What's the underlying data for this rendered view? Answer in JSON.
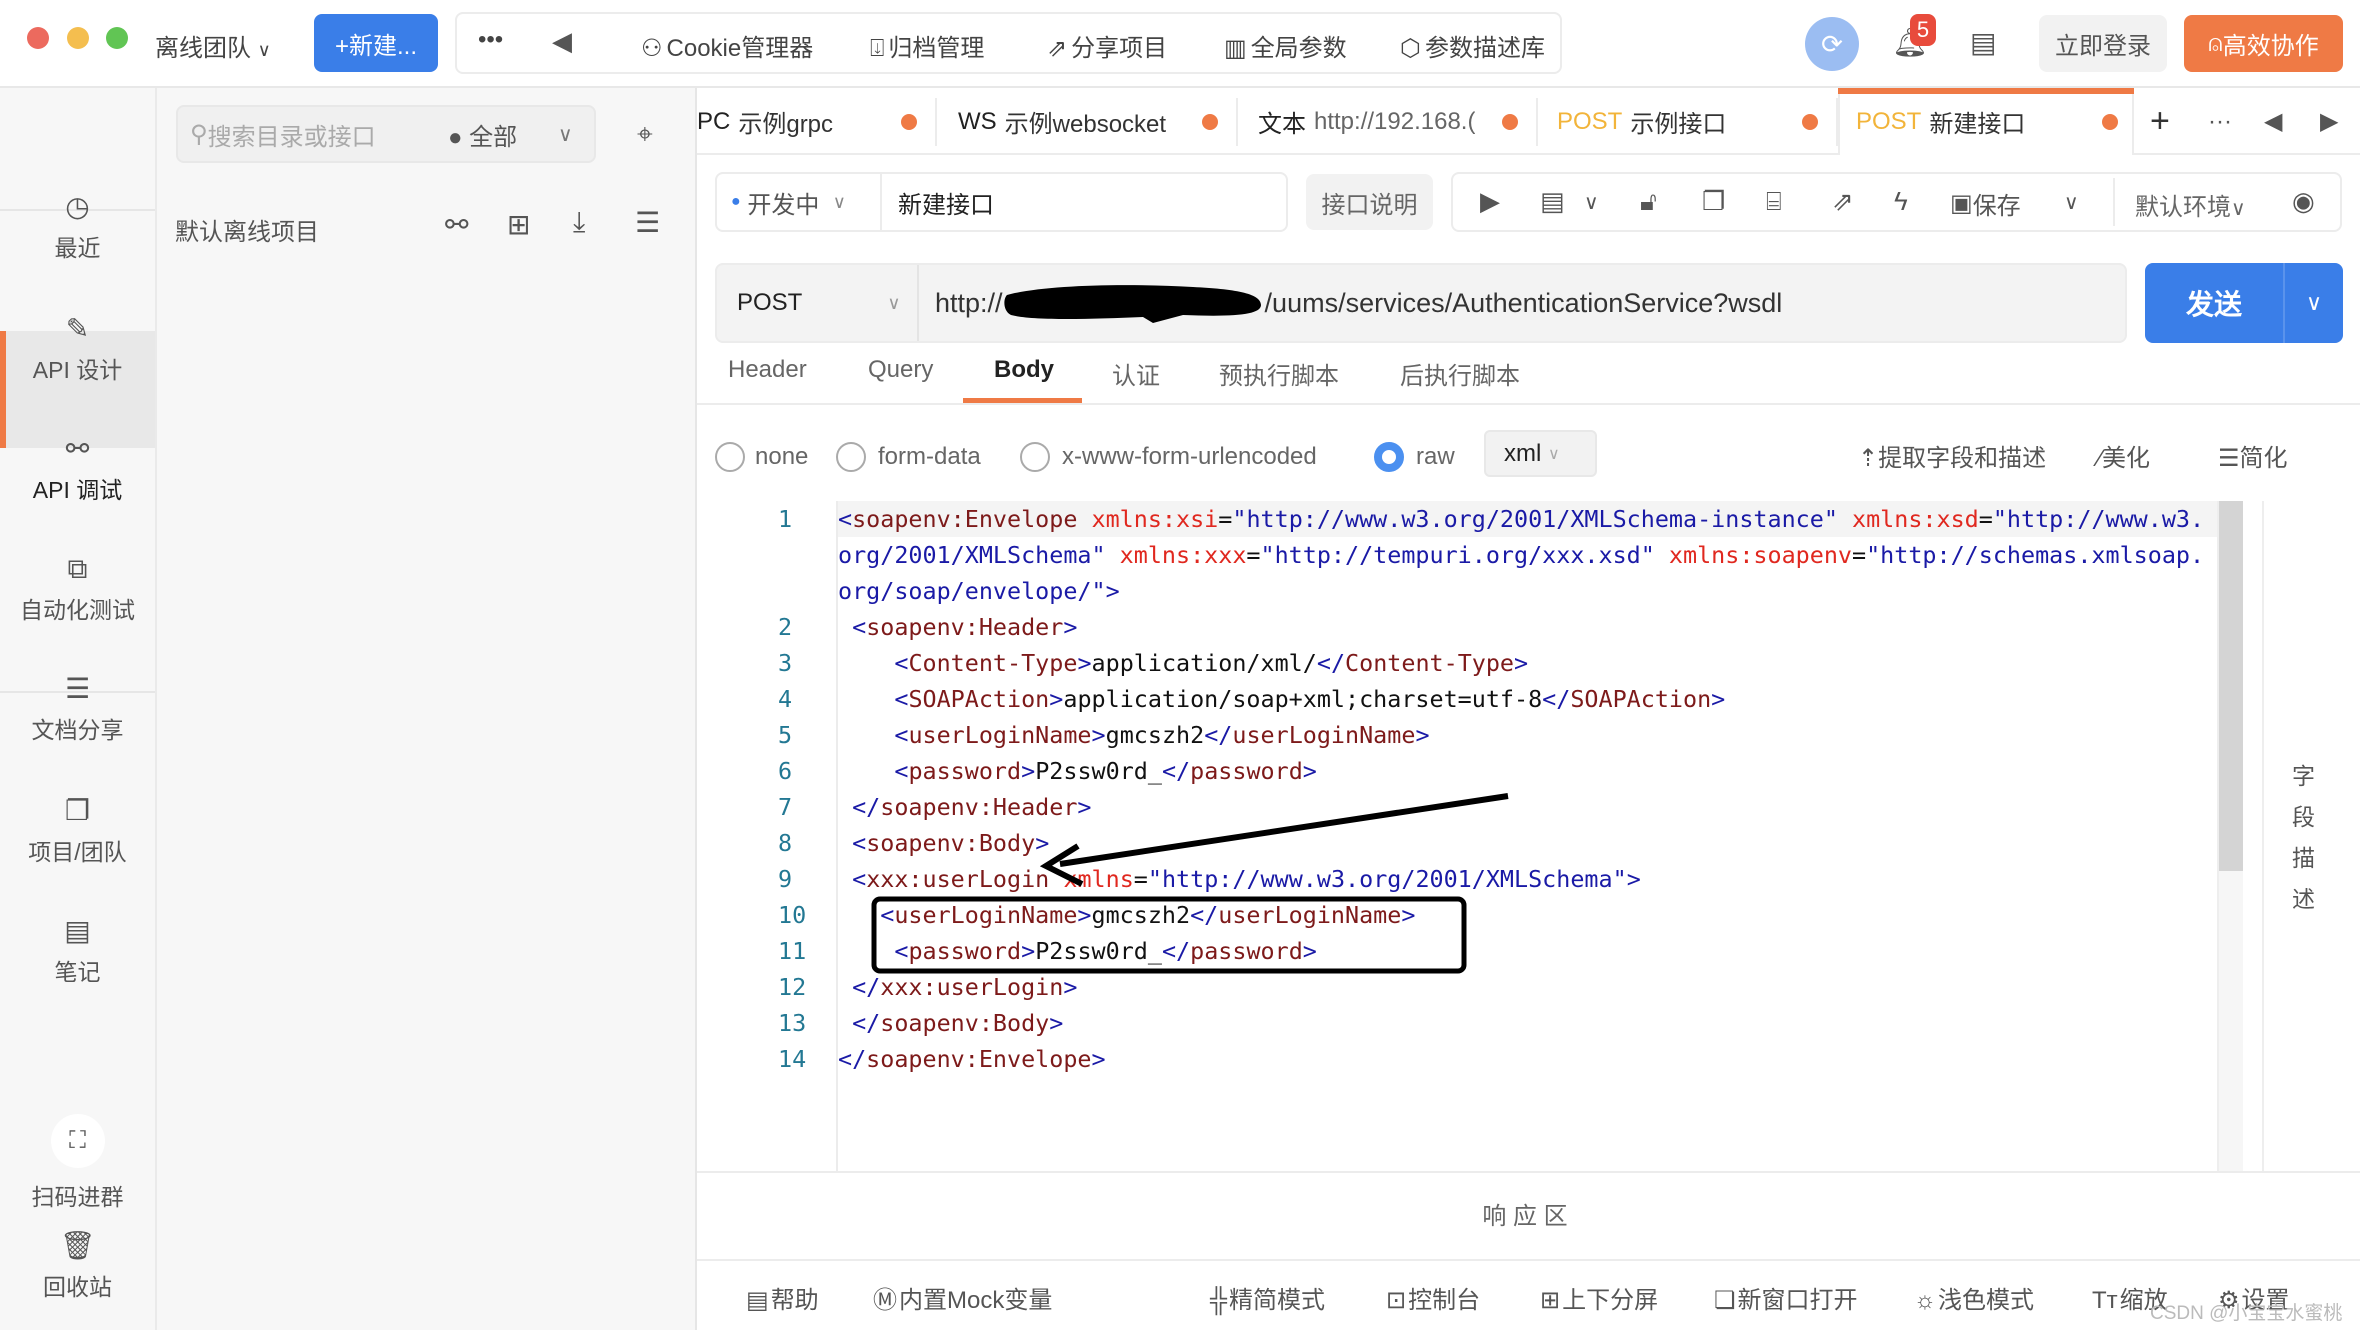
{
  "topbar": {
    "team": "离线团队",
    "new_button": "+新建...",
    "more": "•••",
    "tools": [
      {
        "icon": "cookie-icon",
        "glyph": "⚇",
        "label": "Cookie管理器"
      },
      {
        "icon": "archive-icon",
        "glyph": "⍗",
        "label": "归档管理"
      },
      {
        "icon": "share-icon",
        "glyph": "⇗",
        "label": "分享项目"
      },
      {
        "icon": "sliders-icon",
        "glyph": "▥",
        "label": "全局参数"
      },
      {
        "icon": "cube-icon",
        "glyph": "⬡",
        "label": "参数描述库"
      }
    ],
    "notification_count": "5",
    "login": "立即登录",
    "collab": "高效协作",
    "accent": "#ef7a45",
    "primary": "#3a7ee8"
  },
  "sidebar": {
    "items": [
      {
        "label": "最近",
        "icon": "clock-icon",
        "glyph": "◷"
      },
      {
        "label": "API 设计",
        "icon": "edit-icon",
        "glyph": "✎"
      },
      {
        "label": "API 调试",
        "icon": "plug-icon",
        "glyph": "⚯",
        "active": true
      },
      {
        "label": "自动化测试",
        "icon": "flow-icon",
        "glyph": "⧉"
      },
      {
        "label": "文档分享",
        "icon": "doc-share-icon",
        "glyph": "☰"
      },
      {
        "label": "项目/团队",
        "icon": "folder-icon",
        "glyph": "❐"
      },
      {
        "label": "笔记",
        "icon": "note-icon",
        "glyph": "▤"
      },
      {
        "label": "扫码进群",
        "icon": "scan-icon",
        "glyph": "⛶"
      },
      {
        "label": "回收站",
        "icon": "trash-icon",
        "glyph": "🗑"
      }
    ]
  },
  "panel": {
    "search_placeholder": "搜索目录或接口",
    "filter": "全部",
    "project": "默认离线项目"
  },
  "tabs": [
    {
      "method": "PC",
      "name": "示例grpc"
    },
    {
      "method": "WS",
      "name": "示例websocket"
    },
    {
      "method": "文本",
      "name": "http://192.168.("
    },
    {
      "method": "POST",
      "name": "示例接口"
    },
    {
      "method": "POST",
      "name": "新建接口",
      "active": true
    }
  ],
  "request": {
    "status": "开发中",
    "name": "新建接口",
    "doc_button": "接口说明",
    "save": "保存",
    "env": "默认环境",
    "method": "POST",
    "url_prefix": "http://",
    "url_suffix": "/uums/services/AuthenticationService?wsdl",
    "send": "发送"
  },
  "subtabs": [
    "Header",
    "Query",
    "Body",
    "认证",
    "预执行脚本",
    "后执行脚本"
  ],
  "body": {
    "types": [
      "none",
      "form-data",
      "x-www-form-urlencoded",
      "raw"
    ],
    "selected": "raw",
    "format": "xml",
    "extract": "提取字段和描述",
    "beautify": "美化",
    "simplify": "简化",
    "field_desc": "字段描述"
  },
  "code": [
    [
      [
        "b",
        "<"
      ],
      [
        "t",
        "soapenv:Envelope"
      ],
      [
        "x",
        " "
      ],
      [
        "a",
        "xmlns:xsi"
      ],
      [
        "e",
        "="
      ],
      [
        "v",
        "\"http://www.w3.org/2001/XMLSchema-instance\""
      ],
      [
        "x",
        " "
      ],
      [
        "a",
        "xmlns:xsd"
      ],
      [
        "e",
        "="
      ],
      [
        "v",
        "\"http://www.w3.org/2001/XMLSchema\""
      ],
      [
        "x",
        " "
      ],
      [
        "a",
        "xmlns:xxx"
      ],
      [
        "e",
        "="
      ],
      [
        "v",
        "\"http://tempuri.org/xxx.xsd\""
      ],
      [
        "x",
        " "
      ],
      [
        "a",
        "xmlns:soapenv"
      ],
      [
        "e",
        "="
      ],
      [
        "v",
        "\"http://schemas.xmlsoap.org/soap/envelope/\""
      ],
      [
        "b",
        ">"
      ]
    ],
    [
      [
        "x",
        " "
      ],
      [
        "b",
        "<"
      ],
      [
        "t",
        "soapenv:Header"
      ],
      [
        "b",
        ">"
      ]
    ],
    [
      [
        "x",
        "    "
      ],
      [
        "b",
        "<"
      ],
      [
        "t",
        "Content-Type"
      ],
      [
        "b",
        ">"
      ],
      [
        "x",
        "application/xml/"
      ],
      [
        "b",
        "</"
      ],
      [
        "t",
        "Content-Type"
      ],
      [
        "b",
        ">"
      ]
    ],
    [
      [
        "x",
        "    "
      ],
      [
        "b",
        "<"
      ],
      [
        "t",
        "SOAPAction"
      ],
      [
        "b",
        ">"
      ],
      [
        "x",
        "application/soap+xml;charset=utf-8"
      ],
      [
        "b",
        "</"
      ],
      [
        "t",
        "SOAPAction"
      ],
      [
        "b",
        ">"
      ]
    ],
    [
      [
        "x",
        "    "
      ],
      [
        "b",
        "<"
      ],
      [
        "t",
        "userLoginName"
      ],
      [
        "b",
        ">"
      ],
      [
        "x",
        "gmcszh2"
      ],
      [
        "b",
        "</"
      ],
      [
        "t",
        "userLoginName"
      ],
      [
        "b",
        ">"
      ]
    ],
    [
      [
        "x",
        "    "
      ],
      [
        "b",
        "<"
      ],
      [
        "t",
        "password"
      ],
      [
        "b",
        ">"
      ],
      [
        "x",
        "P2ssw0rd_"
      ],
      [
        "b",
        "</"
      ],
      [
        "t",
        "password"
      ],
      [
        "b",
        ">"
      ]
    ],
    [
      [
        "x",
        " "
      ],
      [
        "b",
        "</"
      ],
      [
        "t",
        "soapenv:Header"
      ],
      [
        "b",
        ">"
      ]
    ],
    [
      [
        "x",
        " "
      ],
      [
        "b",
        "<"
      ],
      [
        "t",
        "soapenv:Body"
      ],
      [
        "b",
        ">"
      ]
    ],
    [
      [
        "x",
        " "
      ],
      [
        "b",
        "<"
      ],
      [
        "t",
        "xxx:userLogin"
      ],
      [
        "x",
        " "
      ],
      [
        "a",
        "xmlns"
      ],
      [
        "e",
        "="
      ],
      [
        "v",
        "\"http://www.w3.org/2001/XMLSchema\""
      ],
      [
        "b",
        ">"
      ]
    ],
    [
      [
        "x",
        "   "
      ],
      [
        "b",
        "<"
      ],
      [
        "t",
        "userLoginName"
      ],
      [
        "b",
        ">"
      ],
      [
        "x",
        "gmcszh2"
      ],
      [
        "b",
        "</"
      ],
      [
        "t",
        "userLoginName"
      ],
      [
        "b",
        ">"
      ]
    ],
    [
      [
        "x",
        "    "
      ],
      [
        "b",
        "<"
      ],
      [
        "t",
        "password"
      ],
      [
        "b",
        ">"
      ],
      [
        "x",
        "P2ssw0rd_"
      ],
      [
        "b",
        "</"
      ],
      [
        "t",
        "password"
      ],
      [
        "b",
        ">"
      ]
    ],
    [
      [
        "x",
        " "
      ],
      [
        "b",
        "</"
      ],
      [
        "t",
        "xxx:userLogin"
      ],
      [
        "b",
        ">"
      ]
    ],
    [
      [
        "x",
        " "
      ],
      [
        "b",
        "</"
      ],
      [
        "t",
        "soapenv:Body"
      ],
      [
        "b",
        ">"
      ]
    ],
    [
      [
        "b",
        "</"
      ],
      [
        "t",
        "soapenv:Envelope"
      ],
      [
        "b",
        ">"
      ]
    ]
  ],
  "response_area": "响 应 区",
  "bottom": [
    {
      "label": "帮助",
      "icon": "help-icon",
      "glyph": "▤"
    },
    {
      "label": "内置Mock变量",
      "icon": "mock-icon",
      "glyph": "Ⓜ"
    },
    {
      "label": "精简模式",
      "icon": "compact-icon",
      "glyph": "╬"
    },
    {
      "label": "控制台",
      "icon": "console-icon",
      "glyph": "⊡"
    },
    {
      "label": "上下分屏",
      "icon": "split-icon",
      "glyph": "⊞"
    },
    {
      "label": "新窗口打开",
      "icon": "window-icon",
      "glyph": "❏"
    },
    {
      "label": "浅色模式",
      "icon": "sun-icon",
      "glyph": "☼"
    },
    {
      "label": "缩放",
      "icon": "zoom-icon",
      "glyph": "Tт"
    },
    {
      "label": "设置",
      "icon": "settings-icon",
      "glyph": "⚙"
    }
  ],
  "watermark": "CSDN @小宝宝水蜜桃"
}
